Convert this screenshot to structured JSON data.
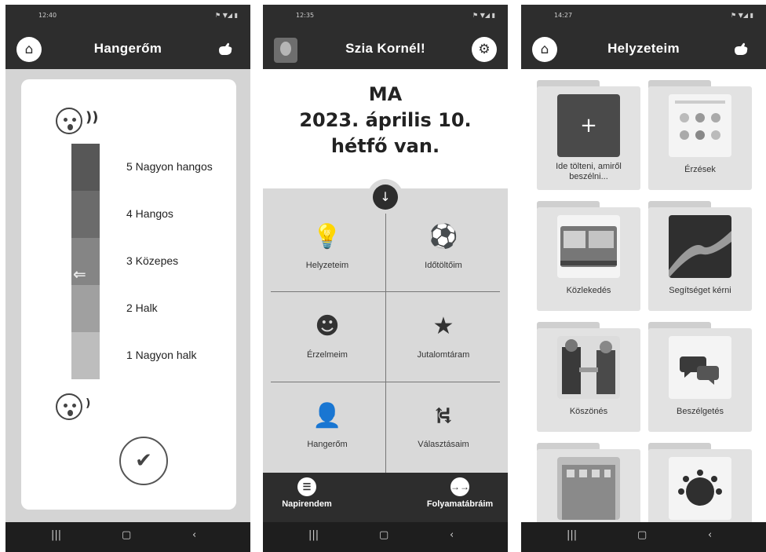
{
  "screen1": {
    "status_time": "12:40",
    "status_icons": "⚑ ▼◢ ▮",
    "title": "Hangerőm",
    "levels": [
      {
        "label": "5 Nagyon hangos",
        "color": "#575757"
      },
      {
        "label": "4 Hangos",
        "color": "#6b6b6b"
      },
      {
        "label": "3 Közepes",
        "color": "#858585"
      },
      {
        "label": "2 Halk",
        "color": "#a0a0a0"
      },
      {
        "label": "1 Nagyon halk",
        "color": "#bdbdbd"
      }
    ],
    "selected_level": 3,
    "pointer_glyph": "⇐",
    "confirm_glyph": "✔"
  },
  "screen2": {
    "status_time": "12:35",
    "status_icons": "⚑ ▼◢ ▮",
    "greeting": "Szia Kornél!",
    "date_lines": [
      "MA",
      "2023. április 10.",
      "hétfő van."
    ],
    "tiles": [
      {
        "label": "Helyzeteim",
        "icon": "lightbulb-icon",
        "glyph": "💡"
      },
      {
        "label": "Időtöltőim",
        "icon": "soccer-ball-icon",
        "glyph": "⚽"
      },
      {
        "label": "Érzelmeim",
        "icon": "smiley-icon",
        "glyph": "☻"
      },
      {
        "label": "Jutalomtáram",
        "icon": "star-icon",
        "glyph": "★"
      },
      {
        "label": "Hangerőm",
        "icon": "speaker-person-icon",
        "glyph": "👤"
      },
      {
        "label": "Választásaim",
        "icon": "signpost-icon",
        "glyph": "⛕"
      }
    ],
    "bottom_tabs": [
      {
        "label": "Napirendem",
        "glyph": "☰"
      },
      {
        "label": "Folyamatábráim",
        "glyph": "→→"
      }
    ]
  },
  "screen3": {
    "status_time": "14:27",
    "status_icons": "⚑ ▼◢ ▮",
    "title": "Helyzeteim",
    "folders": [
      {
        "caption": "Ide tölteni, amiről beszélni...",
        "glyph": "+"
      },
      {
        "caption": "Érzések"
      },
      {
        "caption": "Közlekedés"
      },
      {
        "caption": "Segítséget kérni"
      },
      {
        "caption": "Köszönés"
      },
      {
        "caption": "Beszélgetés"
      },
      {
        "caption": ""
      },
      {
        "caption": ""
      }
    ]
  },
  "nav_glyphs": [
    "|||",
    "▢",
    "‹"
  ],
  "colors": {
    "dark": "#2d2d2d",
    "panel": "#d9d9d9",
    "nav": "#1e1e1e"
  }
}
